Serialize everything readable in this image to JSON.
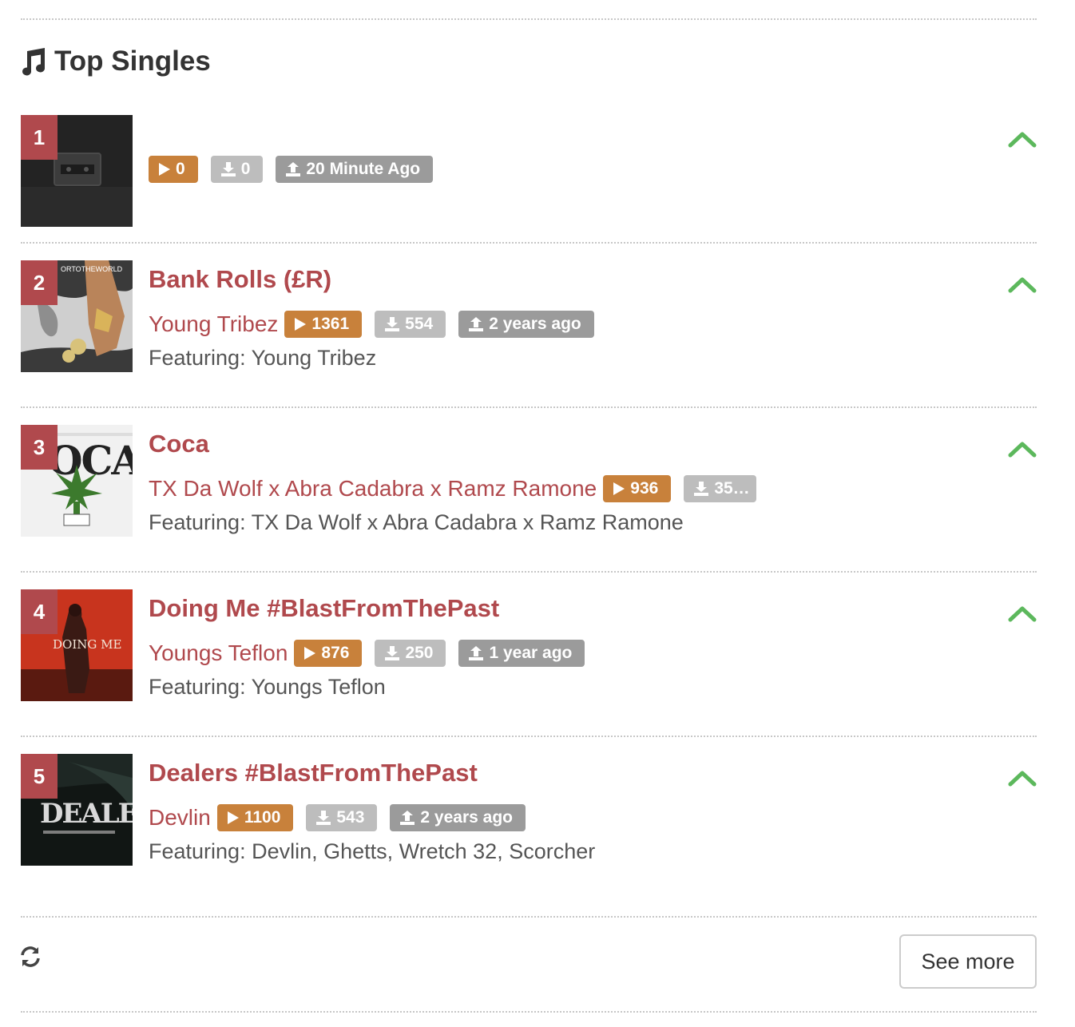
{
  "section": {
    "title": "Top Singles",
    "icon": "music-note-icon"
  },
  "singles": [
    {
      "rank": "1",
      "title": "",
      "artist": "",
      "plays": "0",
      "downloads": "0",
      "uploaded": "20 Minute Ago",
      "featuring": ""
    },
    {
      "rank": "2",
      "title": "Bank Rolls (£R)",
      "artist": "Young Tribez",
      "plays": "1361",
      "downloads": "554",
      "uploaded": "2 years ago",
      "featuring": "Featuring: Young Tribez"
    },
    {
      "rank": "3",
      "title": "Coca",
      "artist": "TX Da Wolf x Abra Cadabra x Ramz Ramone",
      "plays": "936",
      "downloads": "35…",
      "uploaded": "",
      "featuring": "Featuring: TX Da Wolf x Abra Cadabra x Ramz Ramone"
    },
    {
      "rank": "4",
      "title": "Doing Me #BlastFromThePast",
      "artist": "Youngs Teflon",
      "plays": "876",
      "downloads": "250",
      "uploaded": "1 year ago",
      "featuring": "Featuring: Youngs Teflon"
    },
    {
      "rank": "5",
      "title": "Dealers #BlastFromThePast",
      "artist": "Devlin",
      "plays": "1100",
      "downloads": "543",
      "uploaded": "2 years ago",
      "featuring": "Featuring: Devlin, Ghetts, Wretch 32, Scorcher"
    }
  ],
  "cover_art_text": {
    "2": "ORTOTHEWORLD",
    "3": "OCA",
    "4": "DOING ME",
    "5": "DEALERS"
  },
  "footer": {
    "see_more_label": "See more",
    "refresh_icon": "refresh-icon"
  },
  "colors": {
    "accent": "#b0494d",
    "play_badge": "#c8813b",
    "download_badge": "#bdbdbd",
    "upload_badge": "#9b9b9b",
    "trend_up": "#5cb85c"
  }
}
